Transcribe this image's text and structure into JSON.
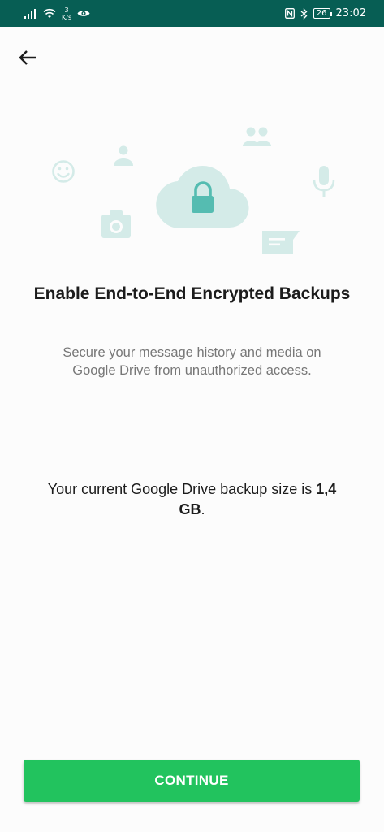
{
  "status_bar": {
    "net_speed_value": "3",
    "net_speed_unit": "K/s",
    "battery": "26",
    "time": "23:02"
  },
  "icons": {
    "back": "arrow-left-icon",
    "lock": "lock-icon",
    "cloud": "cloud-icon"
  },
  "colors": {
    "header": "#075e54",
    "accent": "#22c35e",
    "illustration_light": "#d4ebe8",
    "illustration_dark": "#55bcb1"
  },
  "headline": "Enable End-to-End Encrypted Backups",
  "subtitle": "Secure your message history and media on Google Drive from unauthorized access.",
  "backup_info": {
    "prefix": "Your current Google Drive backup size is ",
    "size": "1,4 GB",
    "suffix": "."
  },
  "continue_label": "CONTINUE"
}
